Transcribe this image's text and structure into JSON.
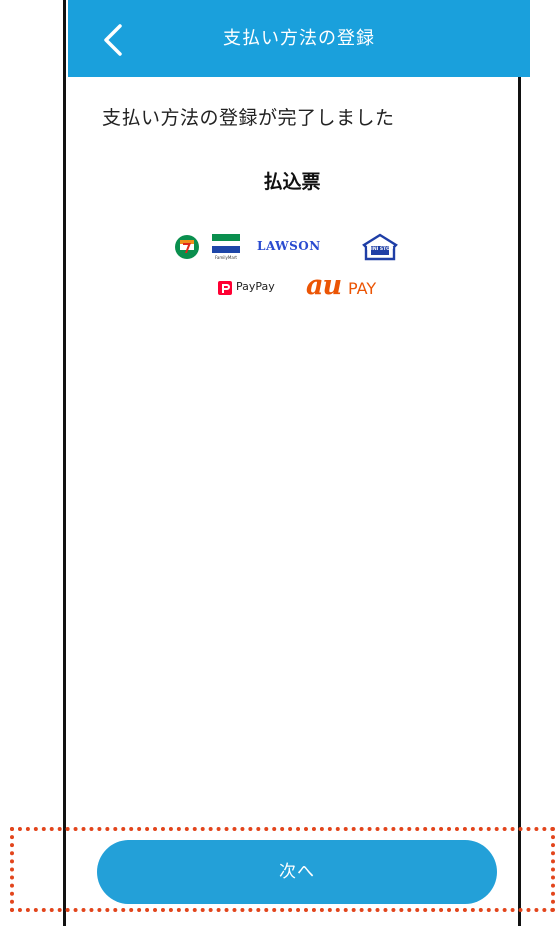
{
  "header": {
    "title": "支払い方法の登録",
    "back_icon": "chevron-left-icon"
  },
  "main": {
    "completion_message": "支払い方法の登録が完了しました",
    "method_name": "払込票",
    "logos": {
      "lawson": "LAWSON",
      "ministop": "MINI STOP",
      "paypay": "PayPay",
      "au_mark": "au",
      "au_pay": "PAY",
      "familymart": "FamilyMart"
    }
  },
  "footer": {
    "next_label": "次へ"
  },
  "colors": {
    "header_bg": "#1aa0dc",
    "button_bg": "#23a0d8",
    "highlight": "#e2451c",
    "au_orange": "#eb5505",
    "lawson_blue": "#2a4bd0"
  }
}
